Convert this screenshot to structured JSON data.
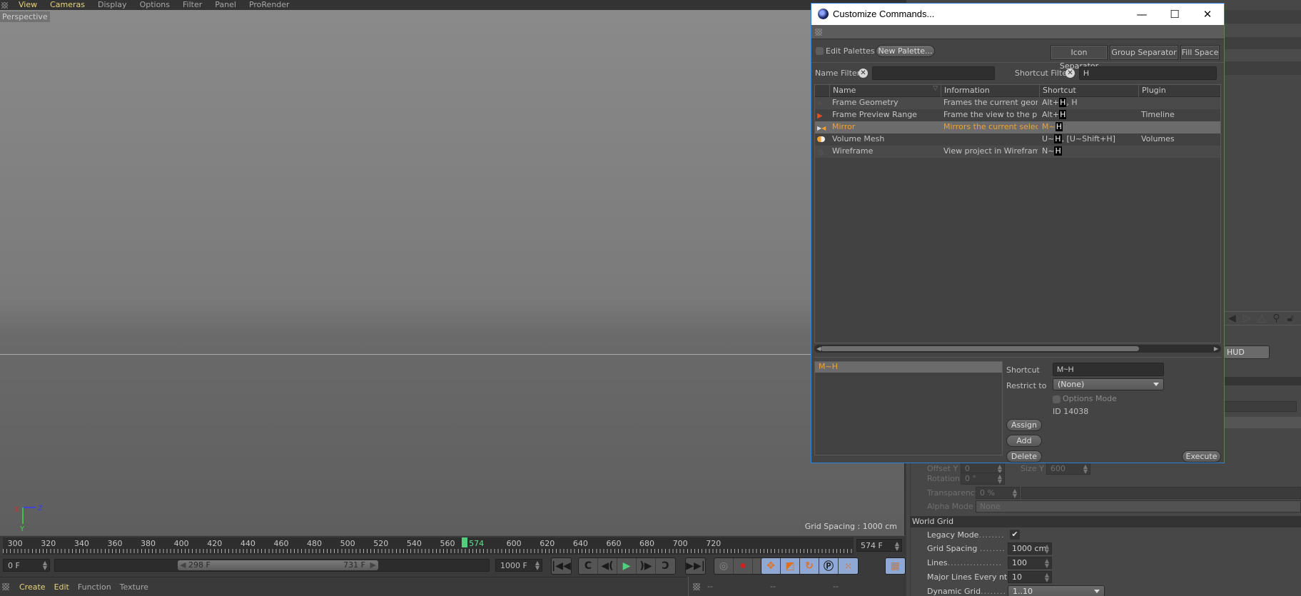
{
  "menubar": {
    "items": [
      {
        "label": "View",
        "active": true
      },
      {
        "label": "Cameras",
        "active": true
      },
      {
        "label": "Display",
        "active": false
      },
      {
        "label": "Options",
        "active": false
      },
      {
        "label": "Filter",
        "active": false
      },
      {
        "label": "Panel",
        "active": false
      },
      {
        "label": "ProRender",
        "active": false
      }
    ]
  },
  "viewport": {
    "label": "Perspective",
    "grid_spacing": "Grid Spacing : 1000 cm",
    "axes": {
      "x": "X",
      "y": "Y",
      "z": "Z"
    }
  },
  "timeline": {
    "ticks": [
      "300",
      "320",
      "340",
      "360",
      "380",
      "400",
      "420",
      "440",
      "460",
      "480",
      "500",
      "520",
      "540",
      "560",
      "574",
      "600",
      "620",
      "640",
      "660",
      "680",
      "700",
      "720"
    ],
    "current_frame_label": "574",
    "current_frame_field": "574 F",
    "start_field": "0 F",
    "range_start": "298 F",
    "range_end": "731 F",
    "end_field": "1000 F"
  },
  "transport": {
    "buttons": [
      "go-to-start",
      "previous-key",
      "previous-frame",
      "play",
      "next-frame",
      "next-key",
      "go-to-end"
    ]
  },
  "bottom_menu": {
    "items": [
      {
        "label": "Create",
        "active": true
      },
      {
        "label": "Edit",
        "active": true
      },
      {
        "label": "Function",
        "active": false
      },
      {
        "label": "Texture",
        "active": false
      }
    ],
    "coords": [
      "--",
      "--",
      "--"
    ]
  },
  "dialog": {
    "title": "Customize Commands...",
    "edit_palettes_label": "Edit Palettes",
    "new_palette_label": "New Palette...",
    "icon_separator_label": "Icon Separator",
    "group_separator_label": "Group Separator",
    "fill_space_label": "Fill Space",
    "name_filter_label": "Name Filter",
    "name_filter_value": "",
    "shortcut_filter_label": "Shortcut Filter",
    "shortcut_filter_value": "H",
    "columns": [
      "Name",
      "Information",
      "Shortcut",
      "Plugin"
    ],
    "rows": [
      {
        "icon": "frame-geometry-icon",
        "name": "Frame Geometry",
        "info": "Frames the current geometry",
        "shortcut_pre": "Alt+",
        "shortcut_key": "H",
        "shortcut_post": ", H",
        "plugin": "",
        "selected": false
      },
      {
        "icon": "frame-preview-range-icon",
        "name": "Frame Preview Range",
        "info": "Frame the view to the preview",
        "shortcut_pre": "Alt+",
        "shortcut_key": "H",
        "shortcut_post": "",
        "plugin": "Timeline",
        "selected": false
      },
      {
        "icon": "mirror-icon",
        "name": "Mirror",
        "info": "Mirrors the current selection",
        "shortcut_pre": "M~",
        "shortcut_key": "H",
        "shortcut_post": "",
        "plugin": "",
        "selected": true
      },
      {
        "icon": "volume-mesh-icon",
        "name": "Volume Mesh",
        "info": "",
        "shortcut_pre": "U~",
        "shortcut_key": "H",
        "shortcut_post": ", [U~Shift+H]",
        "plugin": "Volumes",
        "selected": false
      },
      {
        "icon": "wireframe-icon",
        "name": "Wireframe",
        "info": "View project in Wireframe mode",
        "shortcut_pre": "N~",
        "shortcut_key": "H",
        "shortcut_post": "",
        "plugin": "",
        "selected": false
      }
    ],
    "shortcut_list": [
      "M~H"
    ],
    "shortcut_label": "Shortcut",
    "shortcut_value": "M~H",
    "restrict_to_label": "Restrict to",
    "restrict_to_value": "(None)",
    "options_mode_label": "Options Mode",
    "id_text": "ID 14038",
    "assign_label": "Assign",
    "add_label": "Add",
    "delete_label": "Delete",
    "execute_label": "Execute"
  },
  "attributes": {
    "hud_label": "HUD",
    "offset_y_label": "Offset Y",
    "offset_y_value": "0",
    "size_y_label": "Size Y",
    "size_y_value": "600",
    "rotation_label": "Rotation",
    "rotation_value": "0 °",
    "transparency_label": "Transparency",
    "transparency_value": "0 %",
    "alpha_mode_label": "Alpha Mode",
    "alpha_mode_value": "None",
    "world_grid_label": "World Grid",
    "legacy_mode_label": "Legacy Mode",
    "legacy_mode_checked": "✔",
    "grid_spacing_label": "Grid Spacing",
    "grid_spacing_value": "1000 cm",
    "lines_label": "Lines",
    "lines_value": "100",
    "major_lines_label": "Major Lines Every nth",
    "major_lines_value": "10",
    "dynamic_grid_label": "Dynamic Grid",
    "dynamic_grid_value": "1..10"
  },
  "colors": {
    "accent_orange": "#f0a030",
    "menu_highlight": "#e8d37a",
    "playhead_green": "#4fd07f",
    "dialog_border": "#2b82d8"
  }
}
